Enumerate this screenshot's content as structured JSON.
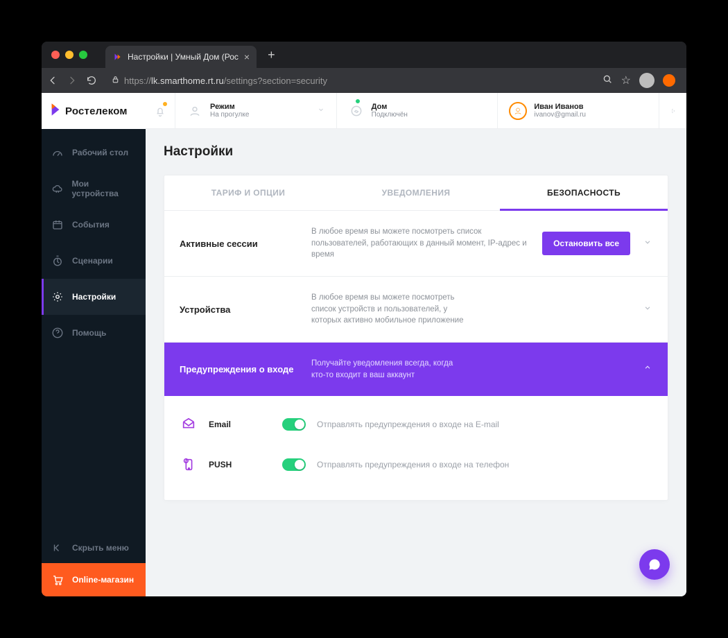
{
  "browser": {
    "tab_title": "Настройки | Умный Дом (Рос",
    "url_host_prefix": "https://",
    "url_host": "lk.smarthome.rt.ru",
    "url_path": "/settings?section=security"
  },
  "brand": {
    "name": "Ростелеком"
  },
  "sidebar": {
    "items": [
      {
        "label": "Рабочий стол"
      },
      {
        "label": "Мои устройства"
      },
      {
        "label": "События"
      },
      {
        "label": "Сценарии"
      },
      {
        "label": "Настройки"
      },
      {
        "label": "Помощь"
      }
    ],
    "collapse": "Скрыть меню",
    "shop": "Online-магазин"
  },
  "topbar": {
    "mode": {
      "title": "Режим",
      "value": "На прогулке"
    },
    "home": {
      "title": "Дом",
      "value": "Подключён"
    },
    "user": {
      "name": "Иван Иванов",
      "email": "ivanov@gmail.ru"
    }
  },
  "page": {
    "title": "Настройки",
    "tabs": [
      {
        "label": "ТАРИФ И ОПЦИИ"
      },
      {
        "label": "УВЕДОМЛЕНИЯ"
      },
      {
        "label": "БЕЗОПАСНОСТЬ"
      }
    ],
    "rows": [
      {
        "name": "Активные сессии",
        "desc": "В любое время вы можете посмотреть список пользователей, работающих в данный момент, IP-адрес и время",
        "button": "Остановить все"
      },
      {
        "name": "Устройства",
        "desc": "В любое время вы можете посмотреть список устройств и пользователей, у которых активно мобильное приложение"
      },
      {
        "name": "Предупреждения о входе",
        "desc": "Получайте уведомления всегда, когда кто-то входит в ваш аккаунт"
      }
    ],
    "alerts": [
      {
        "label": "Email",
        "desc": "Отправлять предупреждения о входе на E-mail"
      },
      {
        "label": "PUSH",
        "desc": "Отправлять предупреждения о входе на телефон"
      }
    ]
  }
}
